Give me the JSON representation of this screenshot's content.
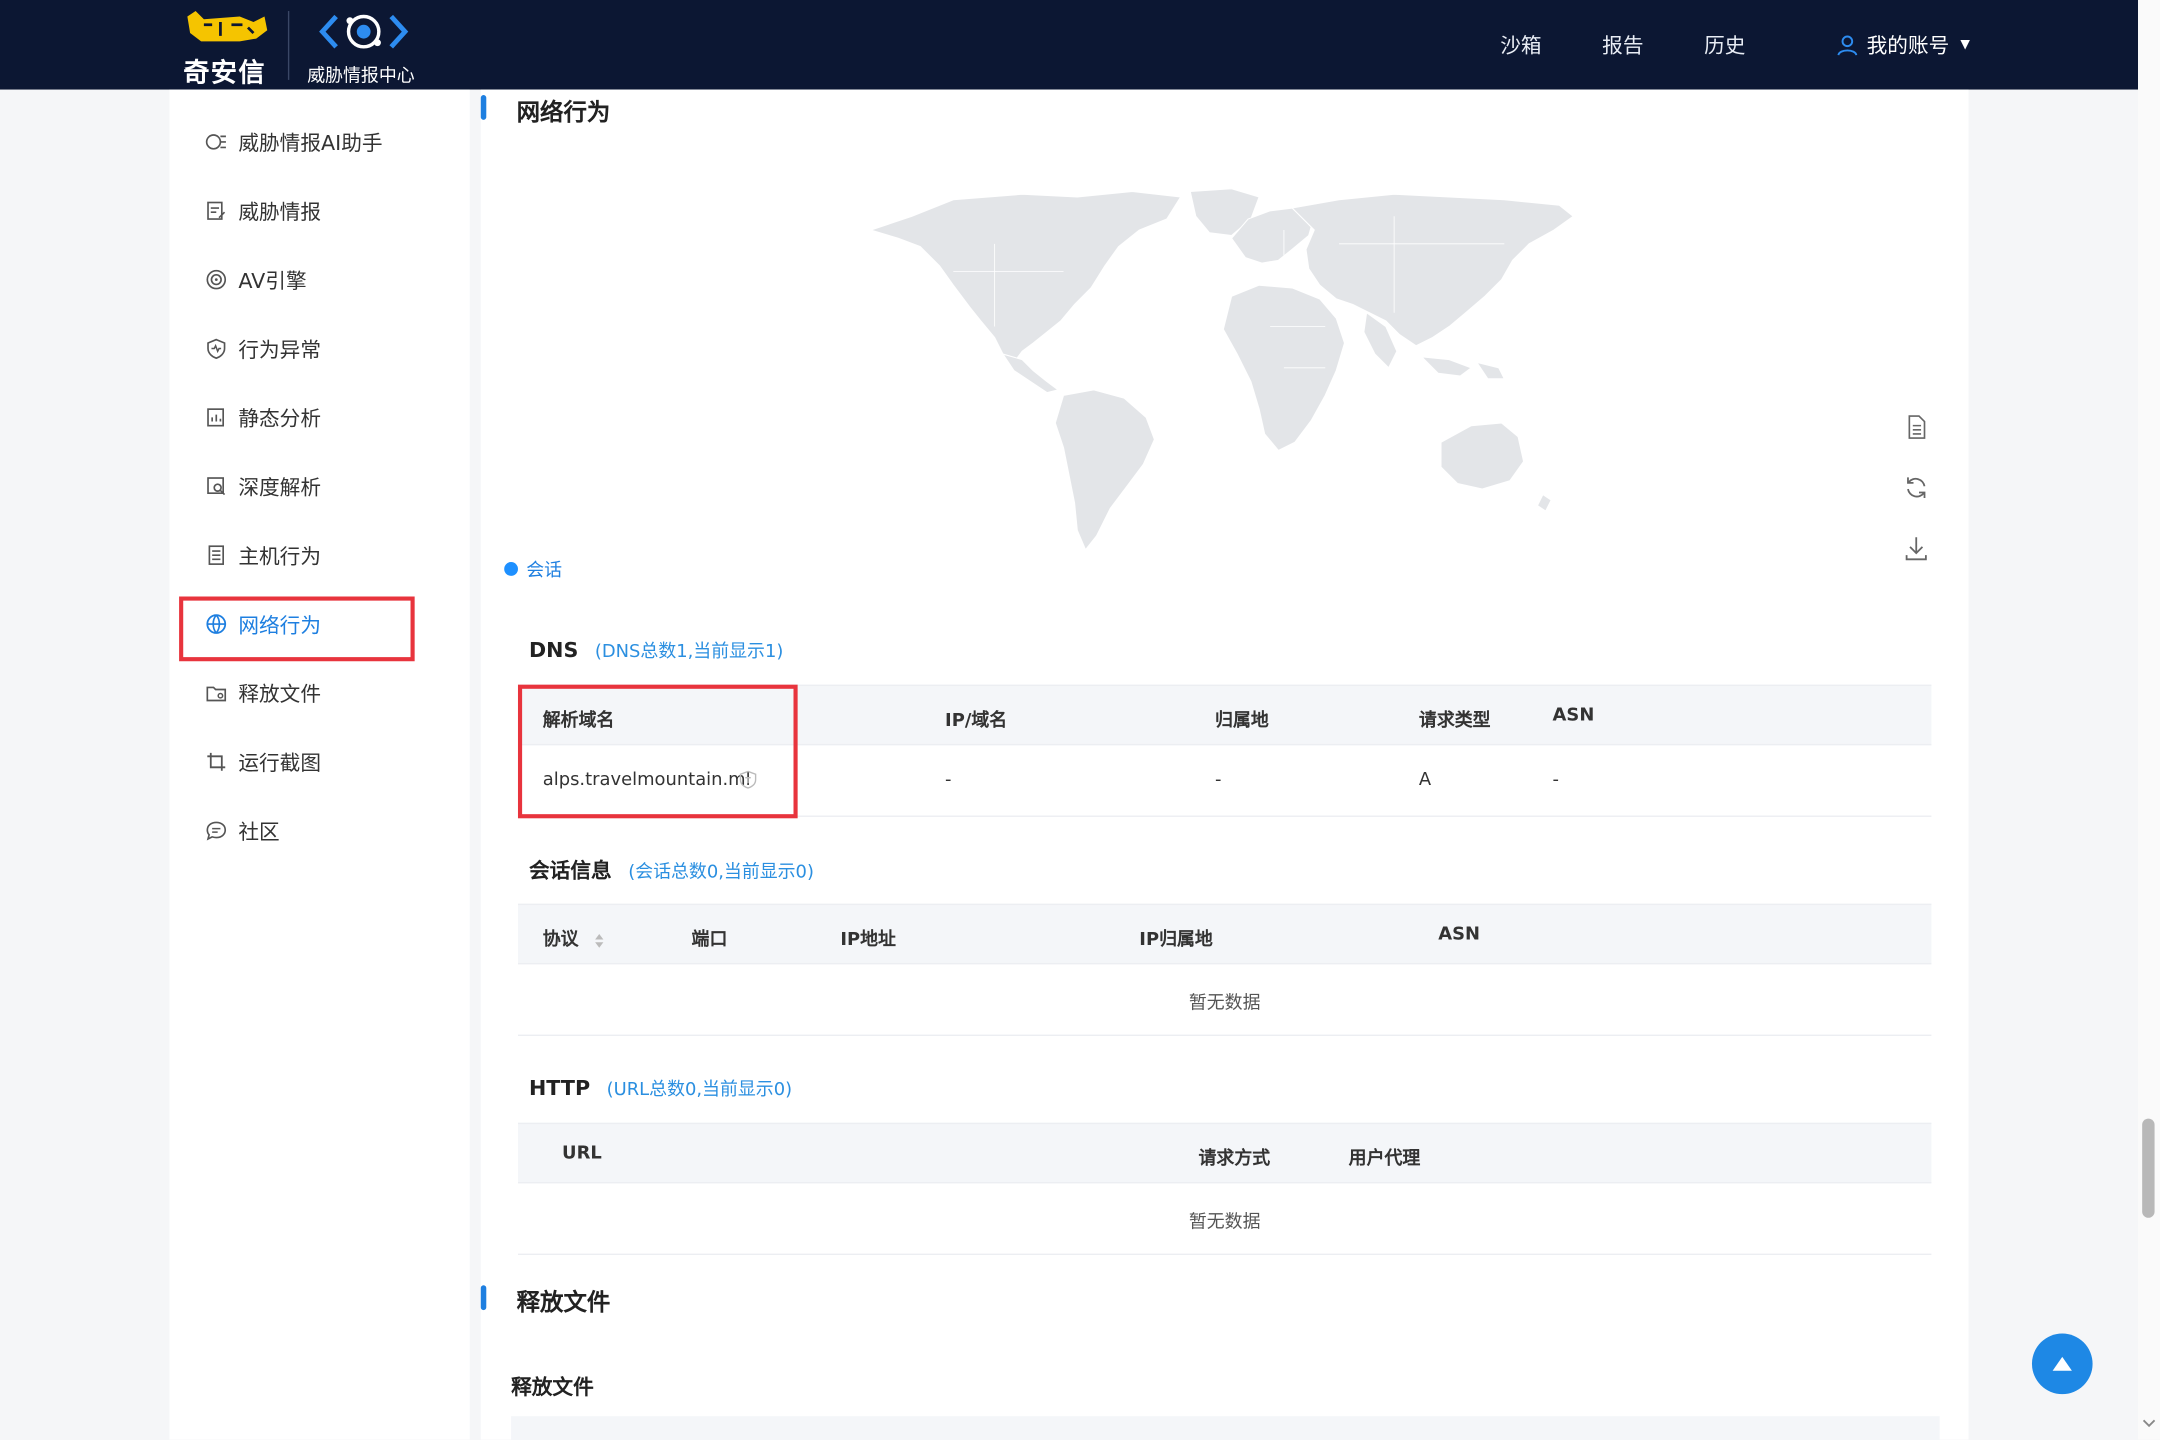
{
  "header": {
    "brand_text": "奇安信",
    "product_name": "威胁情报中心",
    "nav": [
      "沙箱",
      "报告",
      "历史"
    ],
    "account_label": "我的账号"
  },
  "sidebar": {
    "items": [
      {
        "label": "威胁情报AI助手",
        "icon": "brain-icon"
      },
      {
        "label": "威胁情报",
        "icon": "notes-icon"
      },
      {
        "label": "AV引擎",
        "icon": "target-icon"
      },
      {
        "label": "行为异常",
        "icon": "shield-pulse-icon"
      },
      {
        "label": "静态分析",
        "icon": "file-chart-icon"
      },
      {
        "label": "深度解析",
        "icon": "image-search-icon"
      },
      {
        "label": "主机行为",
        "icon": "host-icon"
      },
      {
        "label": "网络行为",
        "icon": "globe-icon",
        "active": true
      },
      {
        "label": "释放文件",
        "icon": "folder-icon"
      },
      {
        "label": "运行截图",
        "icon": "crop-icon"
      },
      {
        "label": "社区",
        "icon": "chat-icon"
      }
    ]
  },
  "network": {
    "section_title": "网络行为",
    "legend_label": "会话",
    "colors": {
      "accent": "#1e7fe0",
      "highlight": "#e8343d",
      "header_bg": "#0c1733"
    }
  },
  "dns": {
    "title": "DNS",
    "count_text": "(DNS总数1,当前显示1)",
    "columns": [
      "解析域名",
      "IP/域名",
      "归属地",
      "请求类型",
      "ASN"
    ],
    "rows": [
      {
        "domain": "alps.travelmountain.ml",
        "ip": "-",
        "location": "-",
        "type": "A",
        "asn": "-"
      }
    ]
  },
  "session": {
    "title": "会话信息",
    "count_text": "(会话总数0,当前显示0)",
    "columns": [
      "协议",
      "端口",
      "IP地址",
      "IP归属地",
      "ASN"
    ],
    "empty_text": "暂无数据"
  },
  "http": {
    "title": "HTTP",
    "count_text": "(URL总数0,当前显示0)",
    "columns": [
      "URL",
      "请求方式",
      "用户代理"
    ],
    "empty_text": "暂无数据"
  },
  "released": {
    "section_title": "释放文件",
    "sub_title": "释放文件"
  }
}
